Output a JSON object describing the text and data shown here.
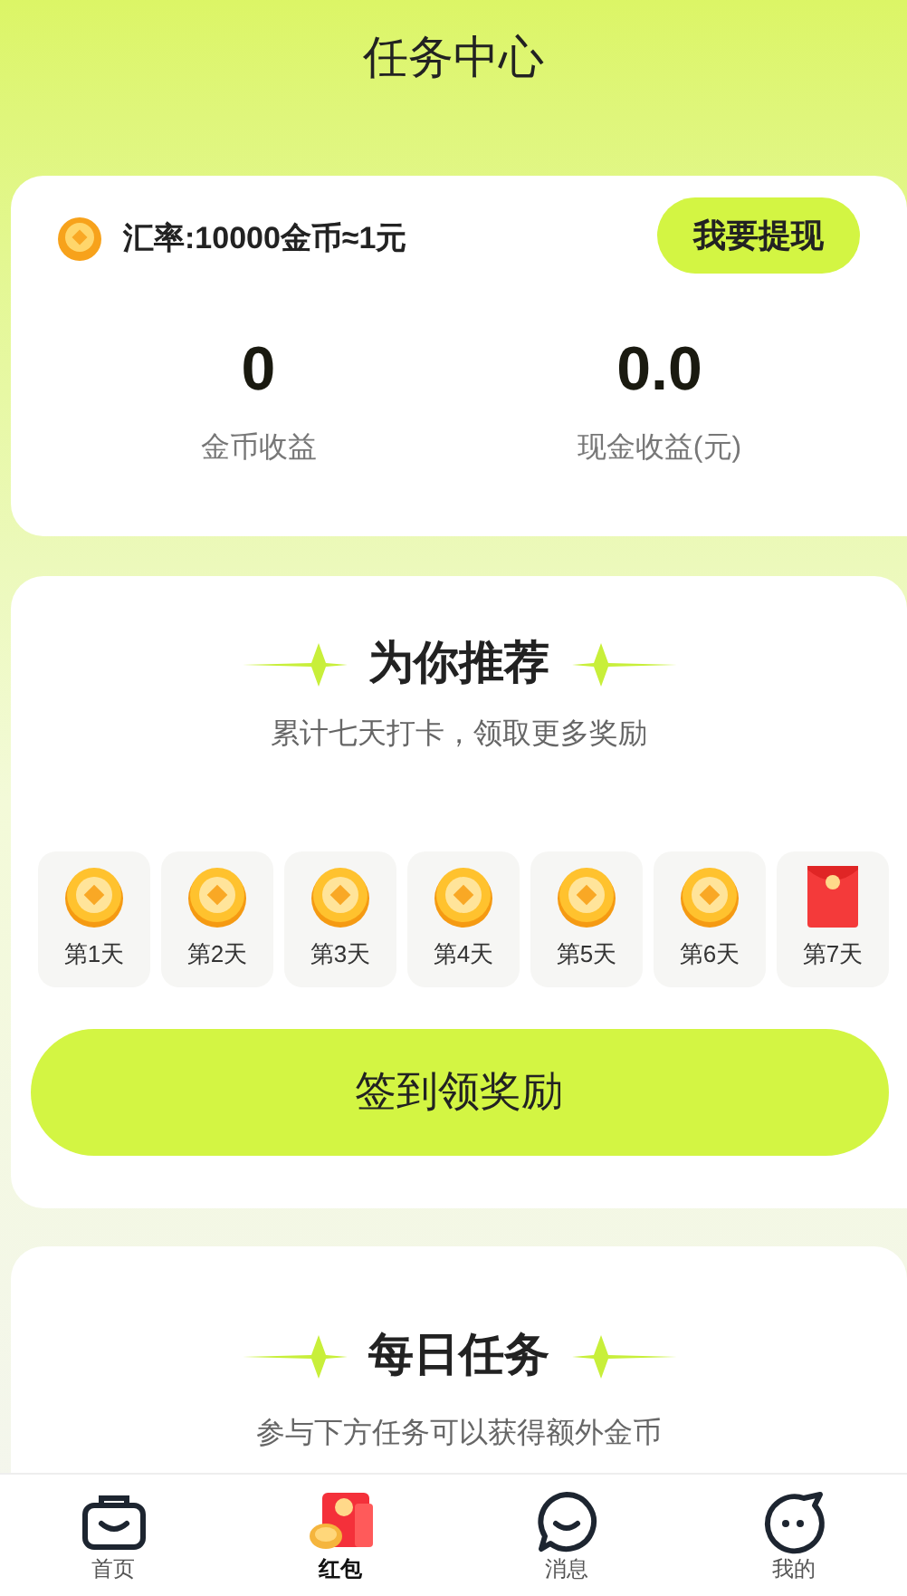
{
  "header": {
    "title": "任务中心"
  },
  "wallet": {
    "rate": "汇率:10000金币≈1元",
    "withdraw_button": "我要提现",
    "stats": [
      {
        "value": "0",
        "label": "金币收益"
      },
      {
        "value": "0.0",
        "label": "现金收益(元)"
      }
    ]
  },
  "checkin": {
    "title": "为你推荐",
    "subtitle": "累计七天打卡，领取更多奖励",
    "days": [
      {
        "label": "第1天",
        "kind": "coin"
      },
      {
        "label": "第2天",
        "kind": "coin"
      },
      {
        "label": "第3天",
        "kind": "coin"
      },
      {
        "label": "第4天",
        "kind": "coin"
      },
      {
        "label": "第5天",
        "kind": "coin"
      },
      {
        "label": "第6天",
        "kind": "coin"
      },
      {
        "label": "第7天",
        "kind": "envelope"
      }
    ],
    "button": "签到领奖励"
  },
  "daily": {
    "title": "每日任务",
    "subtitle": "参与下方任务可以获得额外金币"
  },
  "tab_bar": [
    {
      "label": "首页",
      "kind": "bag",
      "selected": false
    },
    {
      "label": "红包",
      "kind": "envelope",
      "selected": true
    },
    {
      "label": "消息",
      "kind": "chat",
      "selected": false
    },
    {
      "label": "我的",
      "kind": "face",
      "selected": false
    }
  ]
}
